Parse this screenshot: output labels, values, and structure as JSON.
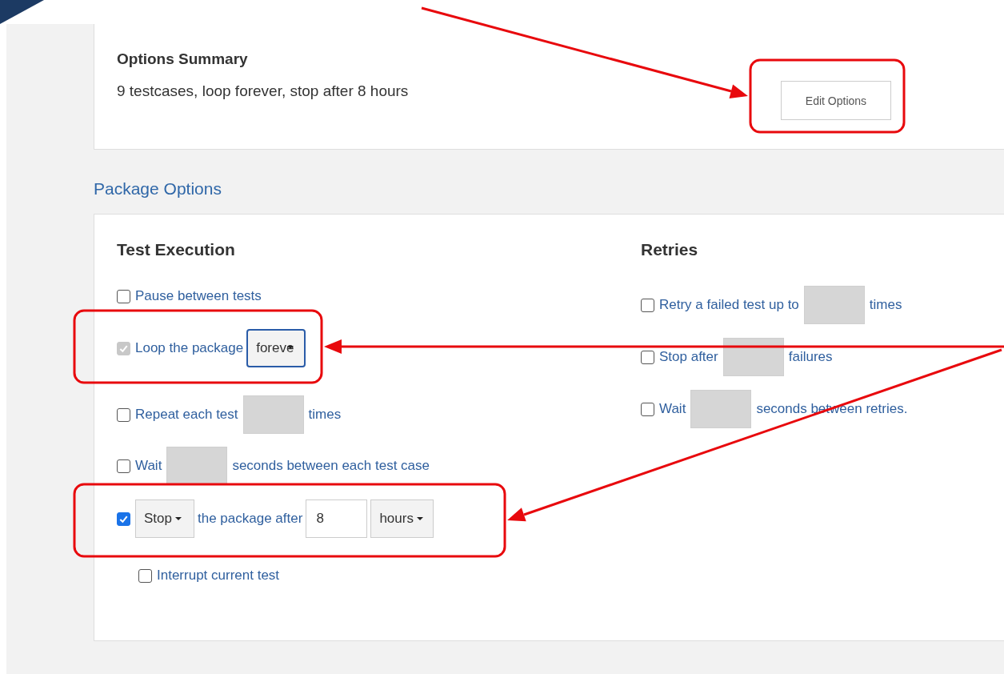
{
  "summary": {
    "heading": "Options Summary",
    "text": "9 testcases, loop forever, stop after 8 hours",
    "button": "Edit Options"
  },
  "package_options": {
    "title": "Package Options",
    "test_execution": {
      "heading": "Test Execution",
      "rows": [
        {
          "checked": false,
          "disabled": false,
          "parts": [
            {
              "kind": "text",
              "text": "Pause between tests"
            }
          ]
        },
        {
          "checked": true,
          "disabled": true,
          "parts": [
            {
              "kind": "text",
              "text": "Loop the package"
            },
            {
              "kind": "select",
              "value": "foreve",
              "focused": true
            }
          ]
        },
        {
          "checked": false,
          "disabled": false,
          "parts": [
            {
              "kind": "text",
              "text": "Repeat each test"
            },
            {
              "kind": "input"
            },
            {
              "kind": "text",
              "text": "times"
            }
          ]
        },
        {
          "checked": false,
          "disabled": false,
          "parts": [
            {
              "kind": "text",
              "text": "Wait"
            },
            {
              "kind": "input"
            },
            {
              "kind": "text",
              "text": "seconds between each test case"
            }
          ]
        },
        {
          "checked": true,
          "disabled": false,
          "parts": [
            {
              "kind": "select",
              "value": "Stop",
              "focused": false
            },
            {
              "kind": "text",
              "text": "the package after"
            },
            {
              "kind": "number",
              "value": "8"
            },
            {
              "kind": "select",
              "value": "hours",
              "focused": false
            }
          ],
          "children": [
            {
              "checked": false,
              "disabled": false,
              "parts": [
                {
                  "kind": "text",
                  "text": "Interrupt current test"
                }
              ]
            }
          ]
        }
      ]
    },
    "retries": {
      "heading": "Retries",
      "rows": [
        {
          "checked": false,
          "disabled": false,
          "parts": [
            {
              "kind": "text",
              "text": "Retry a failed test up to"
            },
            {
              "kind": "input"
            },
            {
              "kind": "text",
              "text": "times"
            }
          ]
        },
        {
          "checked": false,
          "disabled": false,
          "parts": [
            {
              "kind": "text",
              "text": "Stop after"
            },
            {
              "kind": "input"
            },
            {
              "kind": "text",
              "text": "failures"
            }
          ]
        },
        {
          "checked": false,
          "disabled": false,
          "parts": [
            {
              "kind": "text",
              "text": "Wait"
            },
            {
              "kind": "input"
            },
            {
              "kind": "text",
              "text": "seconds between retries."
            }
          ]
        }
      ]
    }
  }
}
